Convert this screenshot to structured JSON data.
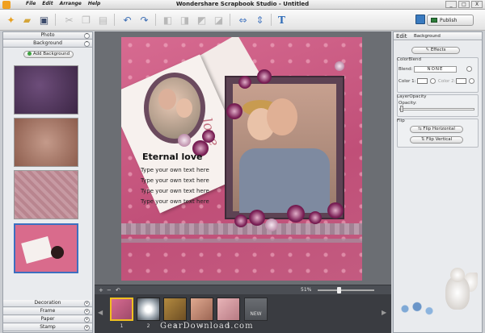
{
  "window": {
    "title": "Wondershare Scrapbook Studio - Untitled",
    "menu": [
      "File",
      "Edit",
      "Arrange",
      "Help"
    ],
    "controls": [
      "_",
      "□",
      "X"
    ]
  },
  "toolbar": {
    "publish_label": "Publish",
    "icons": [
      "new-icon",
      "open-icon",
      "save-icon",
      "cut-icon",
      "copy-icon",
      "paste-icon",
      "undo-icon",
      "redo-icon",
      "bring-front-icon",
      "send-back-icon",
      "group-icon",
      "ungroup-icon",
      "align-icon",
      "distribute-icon",
      "text-icon"
    ]
  },
  "left_panel": {
    "sections_top": [
      "Photo",
      "Background"
    ],
    "add_background_label": "Add Background",
    "sections_bottom": [
      "Decoration",
      "Frame",
      "Paper",
      "Stamp"
    ]
  },
  "canvas": {
    "heading": "Eternal love",
    "love_word": "love",
    "placeholder_lines": [
      "Type your own text here",
      "Type your own text here",
      "Type your own text here",
      "Type your own text here"
    ],
    "zoom": "51%"
  },
  "filmstrip": {
    "page_numbers": [
      "1",
      "2",
      "3",
      "4",
      "5"
    ],
    "new_label": "NEW"
  },
  "right_panel": {
    "tab_edit": "Edit",
    "tab_context": "Background",
    "effects_label": "Effects",
    "colorblend_title": "ColorBlend",
    "blend_label": "Blend:",
    "blend_value": "NONE",
    "color1_label": "Color 1:",
    "color2_label": "Color 2:",
    "layeropacity_title": "LayerOpacity",
    "opacity_label": "Opacity:",
    "flip_title": "Flip",
    "flip_horizontal": "Flip Horizontal",
    "flip_vertical": "Flip Vertical"
  },
  "watermark": "GearDownload.com"
}
